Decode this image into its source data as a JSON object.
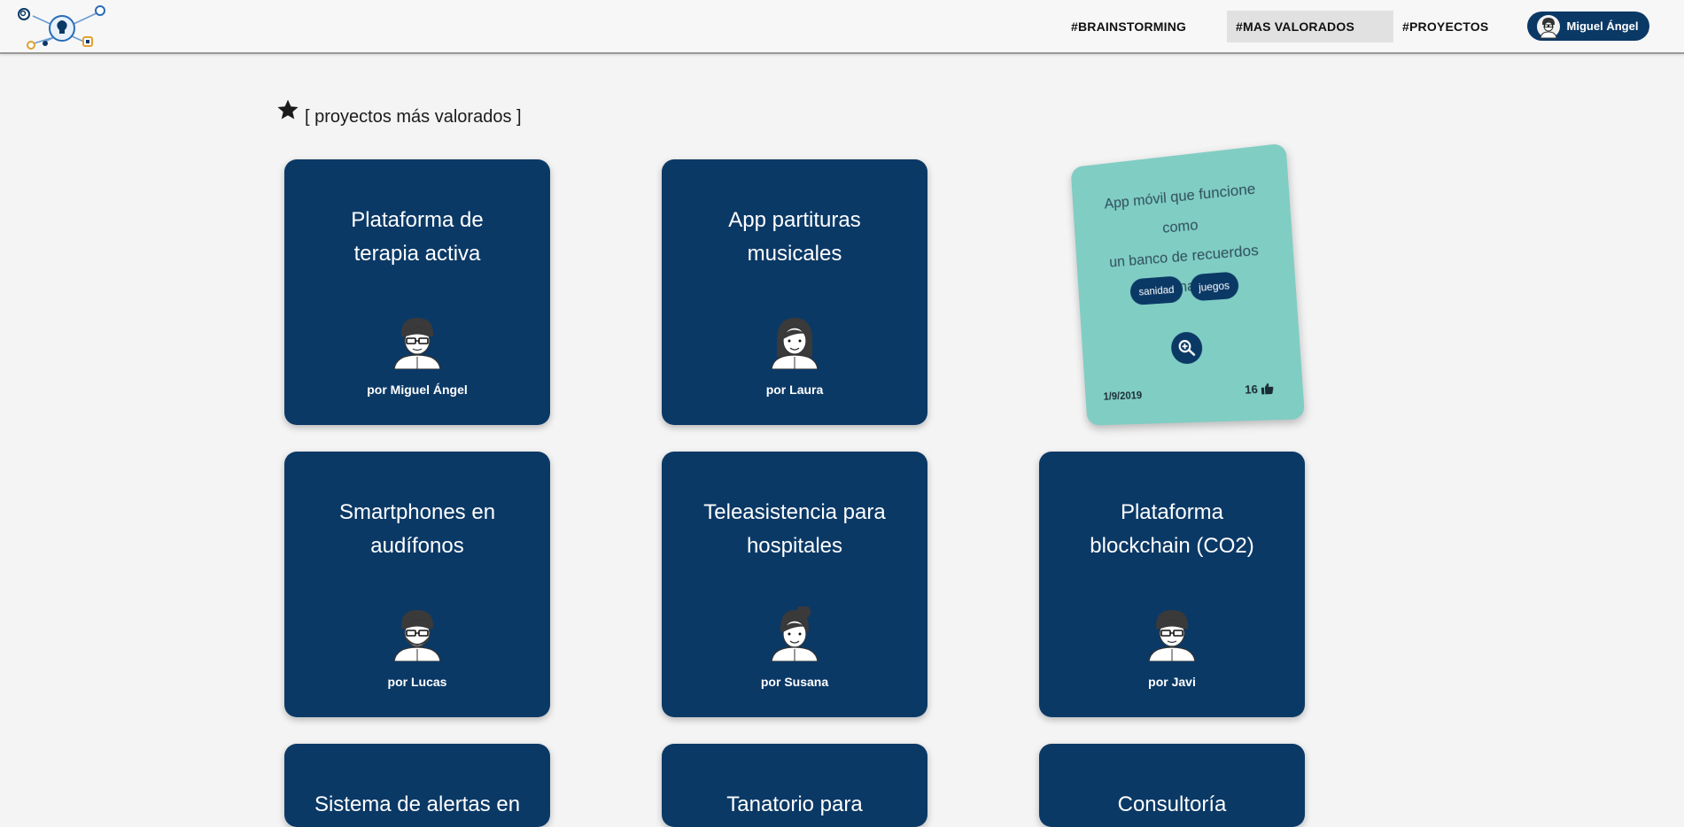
{
  "nav": {
    "brainstorming": "#BRAINSTORMING",
    "mas_valorados": "#MAS VALORADOS",
    "proyectos": "#PROYECTOS"
  },
  "user": {
    "name": "Miguel Ángel"
  },
  "section": {
    "title": "[ proyectos más valorados ]",
    "icon": "star-icon"
  },
  "cards": [
    {
      "title_line1": "Plataforma de",
      "title_line2": "terapia activa",
      "author": "por Miguel Ángel",
      "avatar": "man-glasses-avatar"
    },
    {
      "title_line1": "App partituras",
      "title_line2": "musicales",
      "author": "por Laura",
      "avatar": "woman-long-hair-avatar"
    },
    {
      "title_line1": "Smartphones en",
      "title_line2": "audífonos",
      "author": "por Lucas",
      "avatar": "man-beard-avatar"
    },
    {
      "title_line1": "Teleasistencia para",
      "title_line2": "hospitales",
      "author": "por Susana",
      "avatar": "woman-bun-avatar"
    },
    {
      "title_line1": "Plataforma",
      "title_line2": "blockchain (CO2)",
      "author": "por Javi",
      "avatar": "man-glasses-avatar"
    },
    {
      "title_line1": "Sistema de alertas en",
      "title_line2": ""
    },
    {
      "title_line1": "Tanatorio para",
      "title_line2": ""
    },
    {
      "title_line1": "Consultoría",
      "title_line2": ""
    }
  ],
  "featured": {
    "desc_line1": "App móvil que funcione como",
    "desc_line2": "un banco de recuerdos",
    "desc_line3": "personales...",
    "tags": [
      "sanidad",
      "juegos"
    ],
    "date": "1/9/2019",
    "likes": "16",
    "zoom_icon": "zoom-in-icon",
    "like_icon": "thumbs-up-icon"
  },
  "colors": {
    "navy": "#0b3966",
    "teal": "#80cdc4",
    "background": "#f4f4f4"
  }
}
